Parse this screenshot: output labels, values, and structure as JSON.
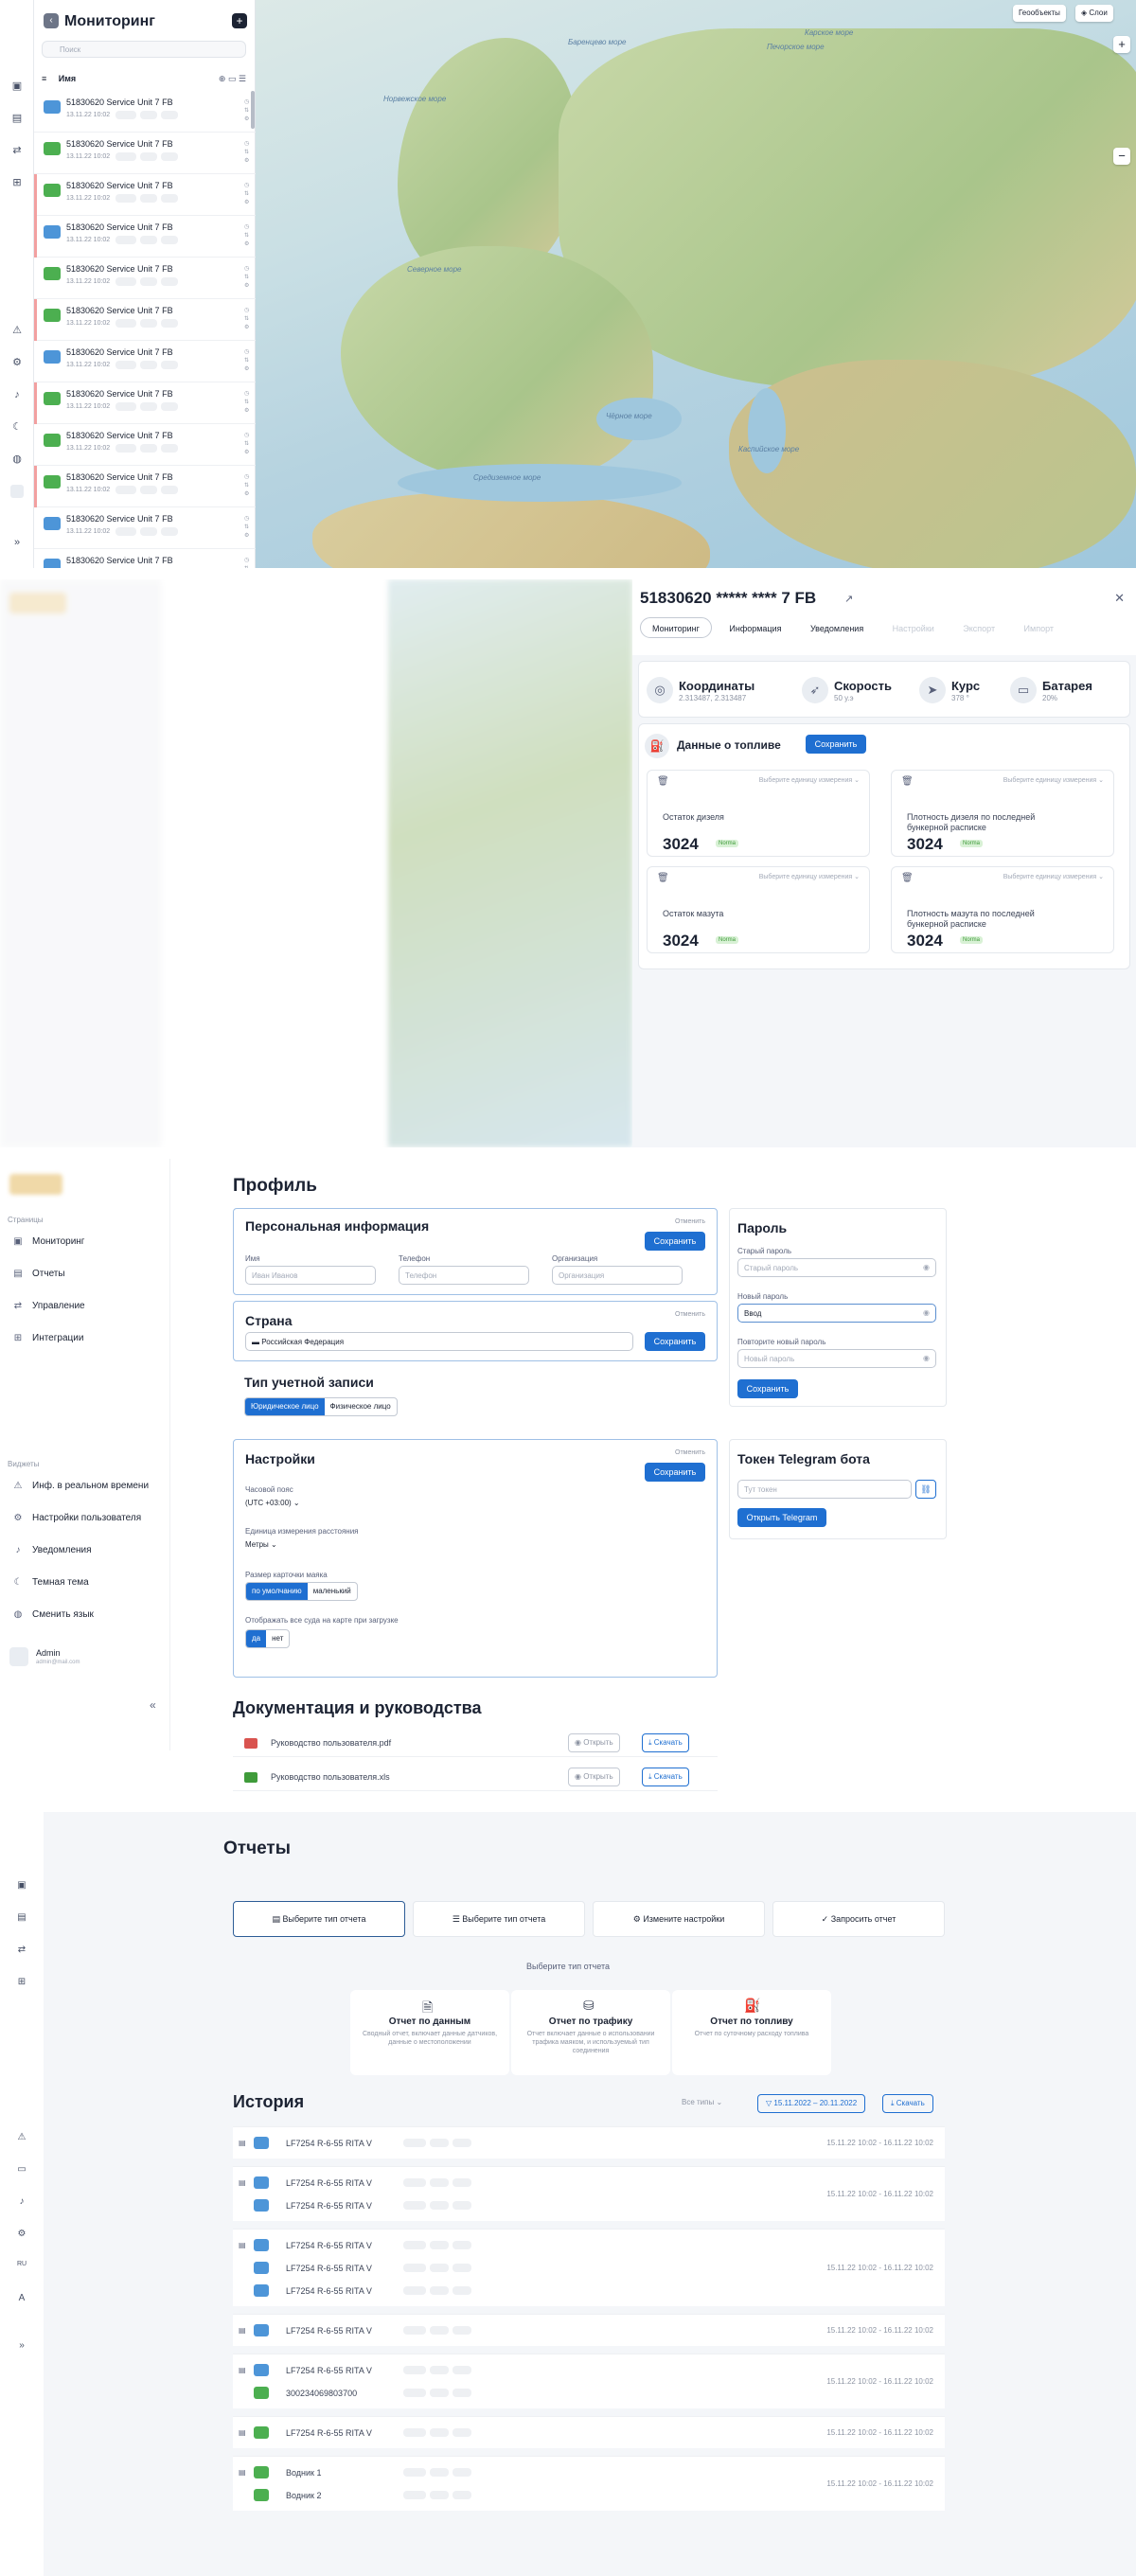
{
  "monitor": {
    "title": "Мониторинг",
    "search_placeholder": "Поиск",
    "sort_label": "Имя",
    "layers_btn": "Геообъекты",
    "layers2_btn": "Слои",
    "zoom_in": "+",
    "zoom_out": "−",
    "rows": [
      {
        "name": "51830620 Service Unit 7 FB",
        "date": "13.11.22 10:02",
        "color": "blue",
        "mark": false
      },
      {
        "name": "51830620 Service Unit 7 FB",
        "date": "13.11.22 10:02",
        "color": "green",
        "mark": false
      },
      {
        "name": "51830620 Service Unit 7 FB",
        "date": "13.11.22 10:02",
        "color": "green",
        "mark": true
      },
      {
        "name": "51830620 Service Unit 7 FB",
        "date": "13.11.22 10:02",
        "color": "blue",
        "mark": true
      },
      {
        "name": "51830620 Service Unit 7 FB",
        "date": "13.11.22 10:02",
        "color": "green",
        "mark": false
      },
      {
        "name": "51830620 Service Unit 7 FB",
        "date": "13.11.22 10:02",
        "color": "green",
        "mark": true
      },
      {
        "name": "51830620 Service Unit 7 FB",
        "date": "13.11.22 10:02",
        "color": "blue",
        "mark": false
      },
      {
        "name": "51830620 Service Unit 7 FB",
        "date": "13.11.22 10:02",
        "color": "green",
        "mark": true
      },
      {
        "name": "51830620 Service Unit 7 FB",
        "date": "13.11.22 10:02",
        "color": "green",
        "mark": false
      },
      {
        "name": "51830620 Service Unit 7 FB",
        "date": "13.11.22 10:02",
        "color": "green",
        "mark": true
      },
      {
        "name": "51830620 Service Unit 7 FB",
        "date": "13.11.22 10:02",
        "color": "blue",
        "mark": false
      },
      {
        "name": "51830620 Service Unit 7 FB",
        "date": "13.11.22 10:02",
        "color": "blue",
        "mark": false
      }
    ],
    "map_labels": [
      {
        "text": "Норвежское море"
      },
      {
        "text": "Баренцево море"
      },
      {
        "text": "Карское море"
      },
      {
        "text": "Печорское море"
      },
      {
        "text": "Северное море"
      },
      {
        "text": "Чёрное море"
      },
      {
        "text": "Каспийское море"
      },
      {
        "text": "Средиземное море"
      }
    ]
  },
  "detail": {
    "title": "51830620 ***** **** 7 FB",
    "tabs": [
      "Мониторинг",
      "Информация",
      "Уведомления",
      "Настройки",
      "Экспорт",
      "Импорт"
    ],
    "metrics": [
      {
        "label": "Координаты",
        "value": "2.313487, 2.313487",
        "icon": "◎"
      },
      {
        "label": "Скорость",
        "value": "50 у.э",
        "icon": "➶"
      },
      {
        "label": "Курс",
        "value": "378 °",
        "icon": "➤"
      },
      {
        "label": "Батарея",
        "value": "20%",
        "icon": "▭"
      }
    ],
    "fuel_title": "Данные о топливе",
    "save": "Сохранить",
    "fuel_cards": [
      {
        "select": "Выберите единицу измерения",
        "label": "Остаток дизеля",
        "value": "3024",
        "badge": "Norma"
      },
      {
        "select": "Выберите единицу измерения",
        "label": "Плотность дизеля по последней бункерной расписке",
        "value": "3024",
        "badge": "Norma"
      },
      {
        "select": "Выберите единицу измерения",
        "label": "Остаток мазута",
        "value": "3024",
        "badge": "Norma"
      },
      {
        "select": "Выберите единицу измерения",
        "label": "Плотность мазута по последней бункерной расписке",
        "value": "3024",
        "badge": "Norma"
      }
    ]
  },
  "profile": {
    "nav_pages_title": "Страницы",
    "nav_pages": [
      "Мониторинг",
      "Отчеты",
      "Управление",
      "Интеграции"
    ],
    "nav_widgets_title": "Виджеты",
    "nav_widgets": [
      "Инф. в реальном времени",
      "Настройки пользователя",
      "Уведомления",
      "Темная тема",
      "Сменить язык"
    ],
    "user_name": "Admin",
    "user_sub": "admin@mail.com",
    "title": "Профиль",
    "personal_title": "Персональная информация",
    "cancel": "Отменить",
    "save": "Сохранить",
    "fields": [
      {
        "label": "Имя",
        "placeholder": "Иван Иванов"
      },
      {
        "label": "Телефон",
        "placeholder": "Телефон"
      },
      {
        "label": "Организация",
        "placeholder": "Организация"
      }
    ],
    "country_title": "Страна",
    "country_value": "Российская Федерация",
    "account_title": "Тип учетной записи",
    "account_opts": [
      "Юридическое лицо",
      "Физическое лицо"
    ],
    "settings_title": "Настройки",
    "tz_label": "Часовой пояс",
    "tz_value": "(UTC +03:00)",
    "unit_label": "Единица измерения расстояния",
    "unit_value": "Метры",
    "marker_label": "Размер карточки маяка",
    "marker_opts": [
      "по умолчанию",
      "маленький"
    ],
    "showall_label": "Отображать все суда на карте при загрузке",
    "showall_opts": [
      "да",
      "нет"
    ],
    "password_title": "Пароль",
    "old_pw_label": "Старый пароль",
    "old_pw_ph": "Старый пароль",
    "new_pw_label": "Новый пароль",
    "new_pw_value": "Ввод",
    "repeat_pw_label": "Повторите новый пароль",
    "repeat_pw_ph": "Новый пароль",
    "tg_title": "Токен Telegram бота",
    "tg_ph": "Тут токен",
    "tg_btn": "Открыть Telegram",
    "docs_title": "Документация и руководства",
    "docs": [
      {
        "name": "Руководство пользователя.pdf",
        "open": "Открыть",
        "dl": "Скачать"
      },
      {
        "name": "Руководство пользователя.xls",
        "open": "Открыть",
        "dl": "Скачать"
      }
    ]
  },
  "reports": {
    "title": "Отчеты",
    "steps": [
      "Выберите тип отчета",
      "Выберите тип отчета",
      "Измените настройки",
      "Запросить отчет"
    ],
    "choose_label": "Выберите тип отчета",
    "types": [
      {
        "title": "Отчет по данным",
        "desc": "Сводный отчет, включает данные датчиков, данные о местоположении"
      },
      {
        "title": "Отчет по трафику",
        "desc": "Отчет включает данные о использовании трафика маяком, и используемый тип соединения"
      },
      {
        "title": "Отчет по топливу",
        "desc": "Отчет по суточному расходу топлива"
      }
    ],
    "history_title": "История",
    "filter_all": "Все типы",
    "date_range": "15.11.2022 – 20.11.2022",
    "download": "Скачать",
    "history": [
      {
        "lines": [
          {
            "name": "LF7254 R-6-55 RITA V",
            "color": "blue"
          }
        ],
        "dates": "15.11.22 10:02 - 16.11.22 10:02"
      },
      {
        "lines": [
          {
            "name": "LF7254 R-6-55 RITA V",
            "color": "blue"
          },
          {
            "name": "LF7254 R-6-55 RITA V",
            "color": "blue"
          }
        ],
        "dates": "15.11.22 10:02 - 16.11.22 10:02"
      },
      {
        "lines": [
          {
            "name": "LF7254 R-6-55 RITA V",
            "color": "blue"
          },
          {
            "name": "LF7254 R-6-55 RITA V",
            "color": "blue"
          },
          {
            "name": "LF7254 R-6-55 RITA V",
            "color": "blue"
          }
        ],
        "dates": "15.11.22 10:02 - 16.11.22 10:02"
      },
      {
        "lines": [
          {
            "name": "LF7254 R-6-55 RITA V",
            "color": "blue"
          }
        ],
        "dates": "15.11.22 10:02 - 16.11.22 10:02"
      },
      {
        "lines": [
          {
            "name": "LF7254 R-6-55 RITA V",
            "color": "blue"
          },
          {
            "name": "300234069803700",
            "color": "green"
          }
        ],
        "dates": "15.11.22 10:02 - 16.11.22 10:02"
      },
      {
        "lines": [
          {
            "name": "LF7254 R-6-55 RITA V",
            "color": "green"
          }
        ],
        "dates": "15.11.22 10:02 - 16.11.22 10:02"
      },
      {
        "lines": [
          {
            "name": "Водник 1",
            "color": "green"
          },
          {
            "name": "Водник 2",
            "color": "green"
          }
        ],
        "dates": "15.11.22 10:02 - 16.11.22 10:02"
      }
    ]
  }
}
